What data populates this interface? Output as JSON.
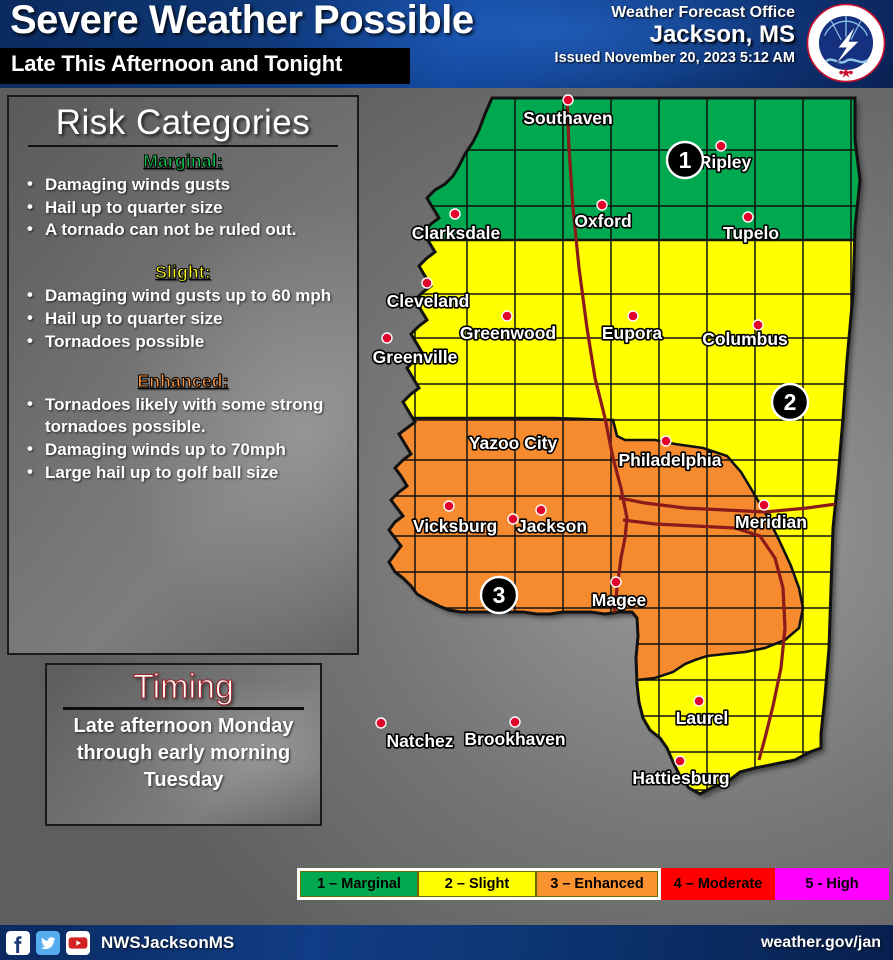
{
  "header": {
    "title": "Severe Weather Possible",
    "subtitle": "Late This Afternoon and Tonight",
    "office_label": "Weather Forecast Office",
    "office_name": "Jackson, MS",
    "issued": "Issued November 20, 2023  5:12 AM",
    "logo_text": "NATIONAL WEATHER SERVICE",
    "accent_blue": "#123f8a"
  },
  "risk_box": {
    "title": "Risk Categories",
    "categories": [
      {
        "heading": "Marginal:",
        "color": "#12c44f",
        "bullets": [
          "Damaging winds gusts",
          "Hail up to quarter size",
          "A tornado can not be ruled out."
        ]
      },
      {
        "heading": "Slight:",
        "color": "#ffff1a",
        "bullets": [
          "Damaging wind gusts up to 60 mph",
          "Hail up to quarter size",
          "Tornadoes possible"
        ]
      },
      {
        "heading": "Enhanced:",
        "color": "#f79646",
        "bullets": [
          "Tornadoes likely with some strong tornadoes possible.",
          "Damaging winds up to 70mph",
          "Large hail up to golf ball size"
        ]
      }
    ]
  },
  "timing_box": {
    "title": "Timing",
    "text": "Late afternoon Monday through early morning Tuesday"
  },
  "legend": {
    "items": [
      {
        "label": "1 – Marginal",
        "color": "#00a94f",
        "active": true
      },
      {
        "label": "2 – Slight",
        "color": "#ffff00",
        "active": true
      },
      {
        "label": "3 – Enhanced",
        "color": "#fb9230",
        "active": true
      },
      {
        "label": "4 – Moderate",
        "color": "#ff0000",
        "active": false
      },
      {
        "label": "5 - High",
        "color": "#ff00ff",
        "active": false
      }
    ]
  },
  "map": {
    "risk_zone_colors": {
      "marginal": "#00a94f",
      "slight": "#ffff00",
      "enhanced": "#f58b2e"
    },
    "risk_markers": [
      {
        "number": "1",
        "zone": "marginal"
      },
      {
        "number": "2",
        "zone": "slight"
      },
      {
        "number": "3",
        "zone": "enhanced"
      }
    ],
    "cities": [
      "Southaven",
      "Ripley",
      "Oxford",
      "Tupelo",
      "Clarksdale",
      "Cleveland",
      "Greenwood",
      "Eupora",
      "Columbus",
      "Greenville",
      "Yazoo City",
      "Philadelphia",
      "Vicksburg",
      "Jackson",
      "Meridian",
      "Magee",
      "Laurel",
      "Natchez",
      "Brookhaven",
      "Hattiesburg"
    ]
  },
  "footer": {
    "handle": "NWSJacksonMS",
    "url": "weather.gov/jan",
    "socials": [
      "facebook-icon",
      "twitter-icon",
      "youtube-icon"
    ]
  }
}
